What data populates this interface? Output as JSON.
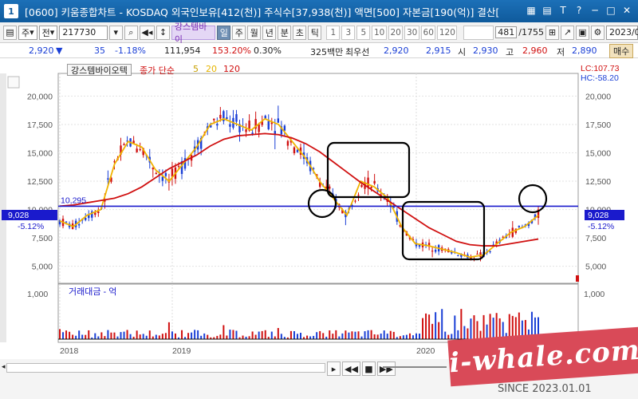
{
  "window": {
    "badge": "1",
    "title": "[0600] 키움종합차트 - KOSDAQ 외국인보유[412(천)] 주식수[37,938(천)] 액면[500] 자본금[190(억)] 결산[",
    "icons": [
      "minimize-icon",
      "restore-icon",
      "close-icon"
    ]
  },
  "toolbar": {
    "period_label": "주",
    "type_label": "전",
    "code_value": "217730",
    "stock_name": "강스템바이",
    "tabs": [
      "일",
      "주",
      "월",
      "년",
      "분",
      "초",
      "틱"
    ],
    "selected_tab": "일",
    "intervals": [
      "1",
      "3",
      "5",
      "10",
      "20",
      "30",
      "60",
      "120"
    ],
    "count_value": "481",
    "count_total": "/1755",
    "date_value": "2023/0",
    "buy_label": "매수"
  },
  "quote": {
    "price": "2,920",
    "arrow": "▼",
    "change": "35",
    "change_pct": "-1.18%",
    "volume": "111,954",
    "vol_ratio": "153.20%",
    "turnover": "0.30%",
    "amount": "325백만",
    "best_bid_label": "최우선",
    "best1": "2,920",
    "best2": "2,915",
    "open_label": "시",
    "open": "2,930",
    "high_label": "고",
    "high": "2,960",
    "low_label": "저",
    "low": "2,890"
  },
  "chart": {
    "legend_name": "강스템바이오텍",
    "ma_label": "종가 단순",
    "ma5": "5",
    "ma20": "20",
    "ma120": "120",
    "lc_label": "LC:107.73",
    "hc_label": "HC:-58.20",
    "hline_label": "10,295",
    "current_price_tag": "9,028",
    "current_pct_tag": "-5.12%",
    "volume_title": "거래대금 - 억",
    "volume_axis_label": "1,000",
    "colors": {
      "price_line": "#1a1acc",
      "ma5": "#f0b400",
      "ma20": "#e6b400",
      "ma120": "#d01010",
      "candle_up": "#d01010",
      "candle_down": "#1a3fd6"
    }
  },
  "chart_data": {
    "type": "line",
    "title": "강스템바이오텍",
    "xlabel": "",
    "ylabel": "",
    "x_ticks": [
      "2018",
      "2019",
      "2020"
    ],
    "y_ticks": [
      "20,000",
      "17,500",
      "15,000",
      "12,500",
      "10,000",
      "7,500",
      "5,000"
    ],
    "ylim": [
      3500,
      22000
    ],
    "horizontal_line": 10295,
    "series": [
      {
        "name": "5",
        "values": [
          9000,
          8500,
          9500,
          10000,
          14000,
          16000,
          15500,
          13500,
          12500,
          14000,
          15500,
          17500,
          18000,
          17500,
          17000,
          18000,
          17500,
          16000,
          14500,
          12500,
          11000,
          9500,
          12500,
          12000,
          11000,
          8500,
          7000,
          6800,
          6500,
          6200,
          5800,
          6000,
          7000,
          8000,
          8500,
          9500
        ]
      },
      {
        "name": "120",
        "values": [
          10300,
          10400,
          10600,
          10800,
          11000,
          11400,
          12000,
          12800,
          13600,
          14200,
          14800,
          15600,
          16200,
          16500,
          16600,
          16700,
          16600,
          16300,
          15800,
          15100,
          14200,
          13300,
          12400,
          11600,
          10800,
          10000,
          9200,
          8400,
          7800,
          7200,
          6900,
          6800,
          6800,
          7000,
          7200,
          7400
        ]
      }
    ]
  },
  "watermark": {
    "text": "i-whale.com",
    "since": "SINCE 2023.01.01"
  }
}
